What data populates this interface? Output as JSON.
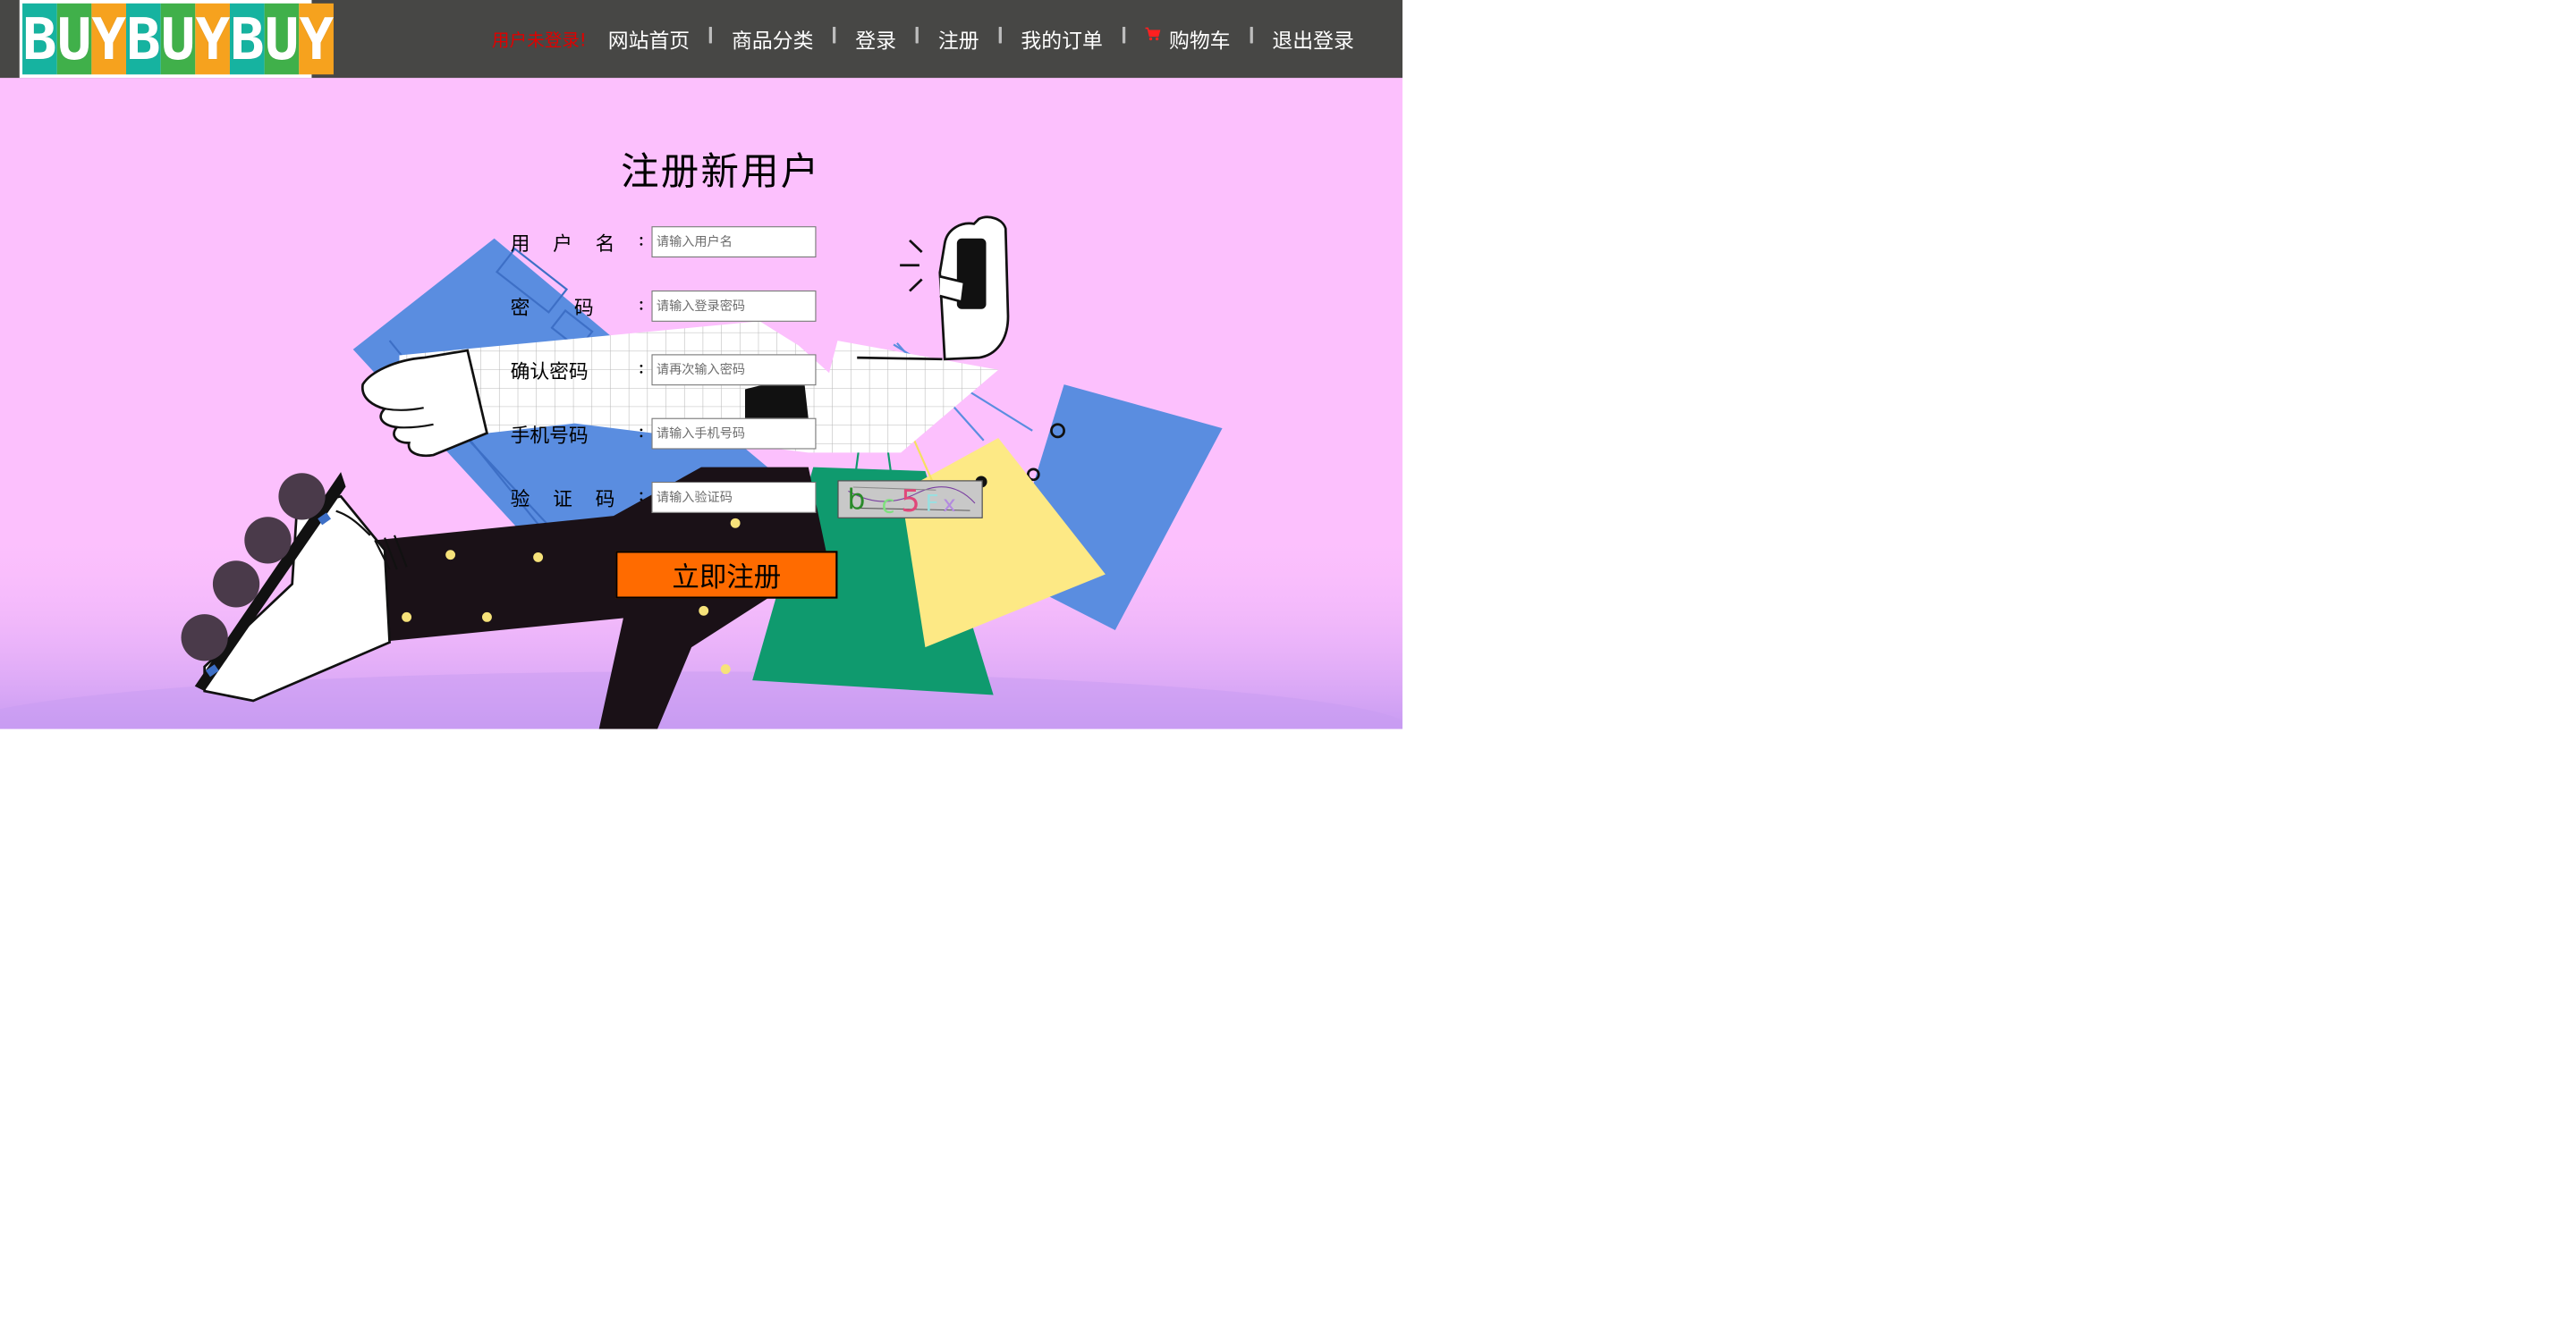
{
  "header": {
    "logo_text": "BUYBUYBUY",
    "login_status": "用户未登录!",
    "nav": [
      {
        "label": "网站首页"
      },
      {
        "label": "商品分类"
      },
      {
        "label": "登录"
      },
      {
        "label": "注册"
      },
      {
        "label": "我的订单"
      },
      {
        "label": "购物车",
        "icon": "cart-icon"
      },
      {
        "label": "退出登录"
      }
    ]
  },
  "form": {
    "title": "注册新用户",
    "fields": [
      {
        "label_chars": [
          "用",
          "户",
          "名"
        ],
        "colon": ":",
        "placeholder": "请输入用户名"
      },
      {
        "label_chars": [
          "密",
          "码"
        ],
        "colon": ":",
        "placeholder": "请输入登录密码"
      },
      {
        "label_chars": [
          "确认密码"
        ],
        "colon": ":",
        "placeholder": "请再次输入密码"
      },
      {
        "label_chars": [
          "手机号码"
        ],
        "colon": ":",
        "placeholder": "请输入手机号码"
      },
      {
        "label_chars": [
          "验",
          "证",
          "码"
        ],
        "colon": ":",
        "placeholder": "请输入验证码"
      }
    ],
    "captcha_text": "bc5Fx",
    "submit_label": "立即注册"
  },
  "colors": {
    "header_bg": "#474745",
    "page_bg": "#fcc0fd",
    "login_status": "#e00000",
    "submit_bg": "#ff6b00",
    "logo_tiles": [
      "#16b3a0",
      "#40b04a",
      "#f6a21e"
    ]
  }
}
